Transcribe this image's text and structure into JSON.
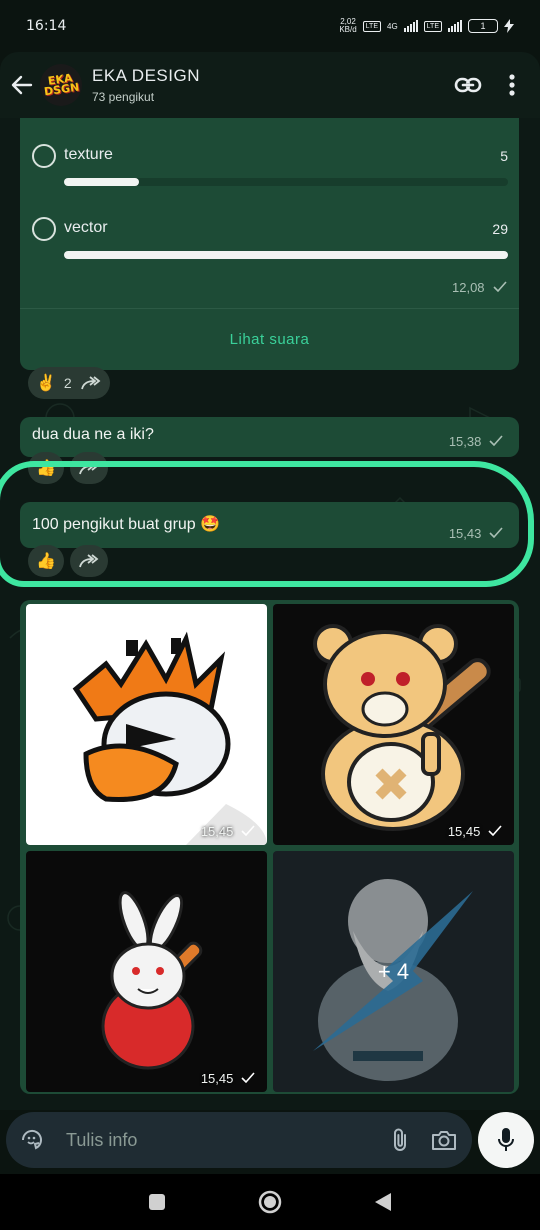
{
  "status_bar": {
    "time": "16:14",
    "speed": "2,02",
    "speed_unit": "KB/d",
    "network": "4G",
    "sim_tag": "LTE",
    "battery": "1"
  },
  "header": {
    "channel_name": "EKA DESIGN",
    "followers": "73 pengikut",
    "avatar_text": "EKA DSGN"
  },
  "poll": {
    "options": [
      {
        "label": "texture",
        "count": "5",
        "fraction": 0.17
      },
      {
        "label": "vector",
        "count": "29",
        "fraction": 1.0
      }
    ],
    "time": "12,08",
    "view_votes_label": "Lihat suara",
    "reactions": [
      {
        "emoji": "✌️",
        "count": "2"
      }
    ]
  },
  "messages": [
    {
      "text": "dua dua ne a iki?",
      "time": "15,38",
      "reaction": "👍"
    },
    {
      "text": "100 pengikut buat grup",
      "emoji": "🤩",
      "time": "15,43",
      "reaction": "👍"
    }
  ],
  "media": {
    "tiles": [
      {
        "time": "15,45"
      },
      {
        "time": "15,45"
      },
      {
        "time": "15,45"
      },
      {
        "more": "+ 4"
      }
    ]
  },
  "composer": {
    "placeholder": "Tulis info"
  },
  "colors": {
    "bubble": "#1d4b36",
    "accent": "#3ad19a",
    "highlight": "#3ee6a0"
  }
}
